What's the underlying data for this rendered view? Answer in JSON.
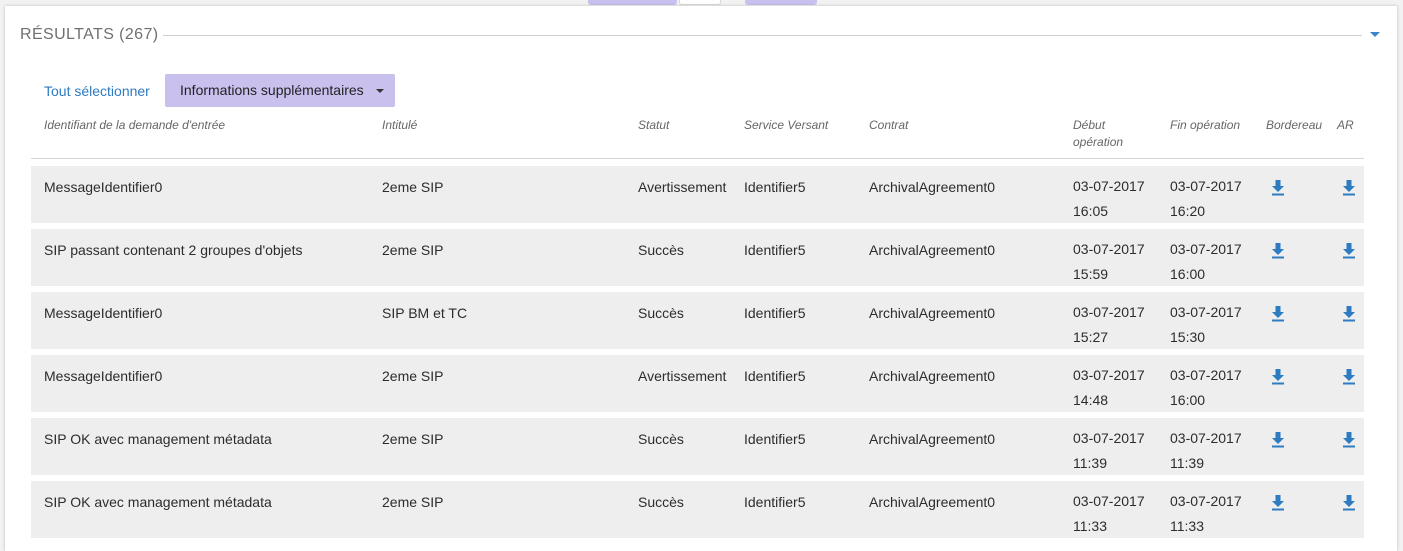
{
  "panel": {
    "title": "RÉSULTATS (267)"
  },
  "toolbar": {
    "select_all": "Tout sélectionner",
    "more_info": "Informations supplémentaires"
  },
  "columns": {
    "id": "Identifiant de la demande d'entrée",
    "title": "Intitulé",
    "status": "Statut",
    "service": "Service Versant",
    "contract": "Contrat",
    "start_line1": "Début",
    "start_line2": "opération",
    "end": "Fin opération",
    "bordereau": "Bordereau",
    "ar": "AR"
  },
  "rows": [
    {
      "id": "MessageIdentifier0",
      "title": "2eme SIP",
      "status": "Avertissement",
      "service": "Identifier5",
      "contract": "ArchivalAgreement0",
      "start_date": "03-07-2017",
      "start_time": "16:05",
      "end_date": "03-07-2017",
      "end_time": "16:20"
    },
    {
      "id": "SIP passant contenant 2 groupes d'objets",
      "title": "2eme SIP",
      "status": "Succès",
      "service": "Identifier5",
      "contract": "ArchivalAgreement0",
      "start_date": "03-07-2017",
      "start_time": "15:59",
      "end_date": "03-07-2017",
      "end_time": "16:00"
    },
    {
      "id": "MessageIdentifier0",
      "title": "SIP BM et TC",
      "status": "Succès",
      "service": "Identifier5",
      "contract": "ArchivalAgreement0",
      "start_date": "03-07-2017",
      "start_time": "15:27",
      "end_date": "03-07-2017",
      "end_time": "15:30"
    },
    {
      "id": "MessageIdentifier0",
      "title": "2eme SIP",
      "status": "Avertissement",
      "service": "Identifier5",
      "contract": "ArchivalAgreement0",
      "start_date": "03-07-2017",
      "start_time": "14:48",
      "end_date": "03-07-2017",
      "end_time": "16:00"
    },
    {
      "id": "SIP OK avec management métadata",
      "title": "2eme SIP",
      "status": "Succès",
      "service": "Identifier5",
      "contract": "ArchivalAgreement0",
      "start_date": "03-07-2017",
      "start_time": "11:39",
      "end_date": "03-07-2017",
      "end_time": "11:39"
    },
    {
      "id": "SIP OK avec management métadata",
      "title": "2eme SIP",
      "status": "Succès",
      "service": "Identifier5",
      "contract": "ArchivalAgreement0",
      "start_date": "03-07-2017",
      "start_time": "11:33",
      "end_date": "03-07-2017",
      "end_time": "11:33"
    }
  ],
  "icons": {
    "download": "download-icon",
    "collapse": "chevron-down-icon",
    "dropdown": "caret-down-icon"
  },
  "colors": {
    "accent_blue": "#2d7bc0",
    "button_lavender": "#c9c0ee",
    "row_background": "#eeeeee"
  }
}
